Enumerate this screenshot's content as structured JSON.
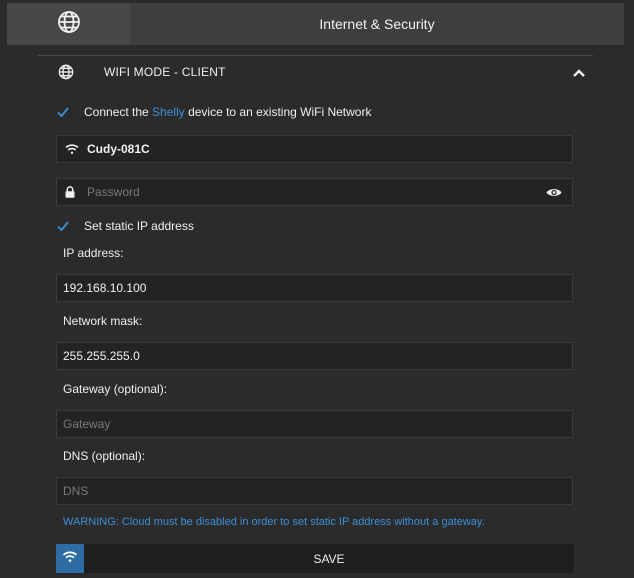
{
  "header": {
    "title": "Internet & Security",
    "globe_icon": "globe-icon"
  },
  "section": {
    "title": "WIFI MODE - CLIENT",
    "icon": "globe-icon",
    "collapse_icon": "chevron-up-icon"
  },
  "connect": {
    "checked": true,
    "text_before": "Connect the ",
    "link": "Shelly",
    "text_after": " device to an existing WiFi Network"
  },
  "ssid": {
    "value": "Cudy-081C",
    "icon": "wifi-icon"
  },
  "password": {
    "value": "",
    "placeholder": "Password",
    "icon": "lock-icon",
    "toggle_icon": "eye-icon"
  },
  "static_ip": {
    "checked": true,
    "label": "Set static IP address"
  },
  "ip_address": {
    "label": "IP address:",
    "value": "192.168.10.100"
  },
  "network_mask": {
    "label": "Network mask:",
    "value": "255.255.255.0"
  },
  "gateway": {
    "label": "Gateway (optional):",
    "value": "",
    "placeholder": "Gateway"
  },
  "dns": {
    "label": "DNS (optional):",
    "value": "",
    "placeholder": "DNS"
  },
  "warning": "WARNING: Cloud must be disabled in order to set static IP address without a gateway.",
  "save": {
    "label": "SAVE",
    "icon": "wifi-icon"
  },
  "colors": {
    "accent": "#3d8fd8",
    "background": "#2b2b2b",
    "field": "#232323"
  }
}
